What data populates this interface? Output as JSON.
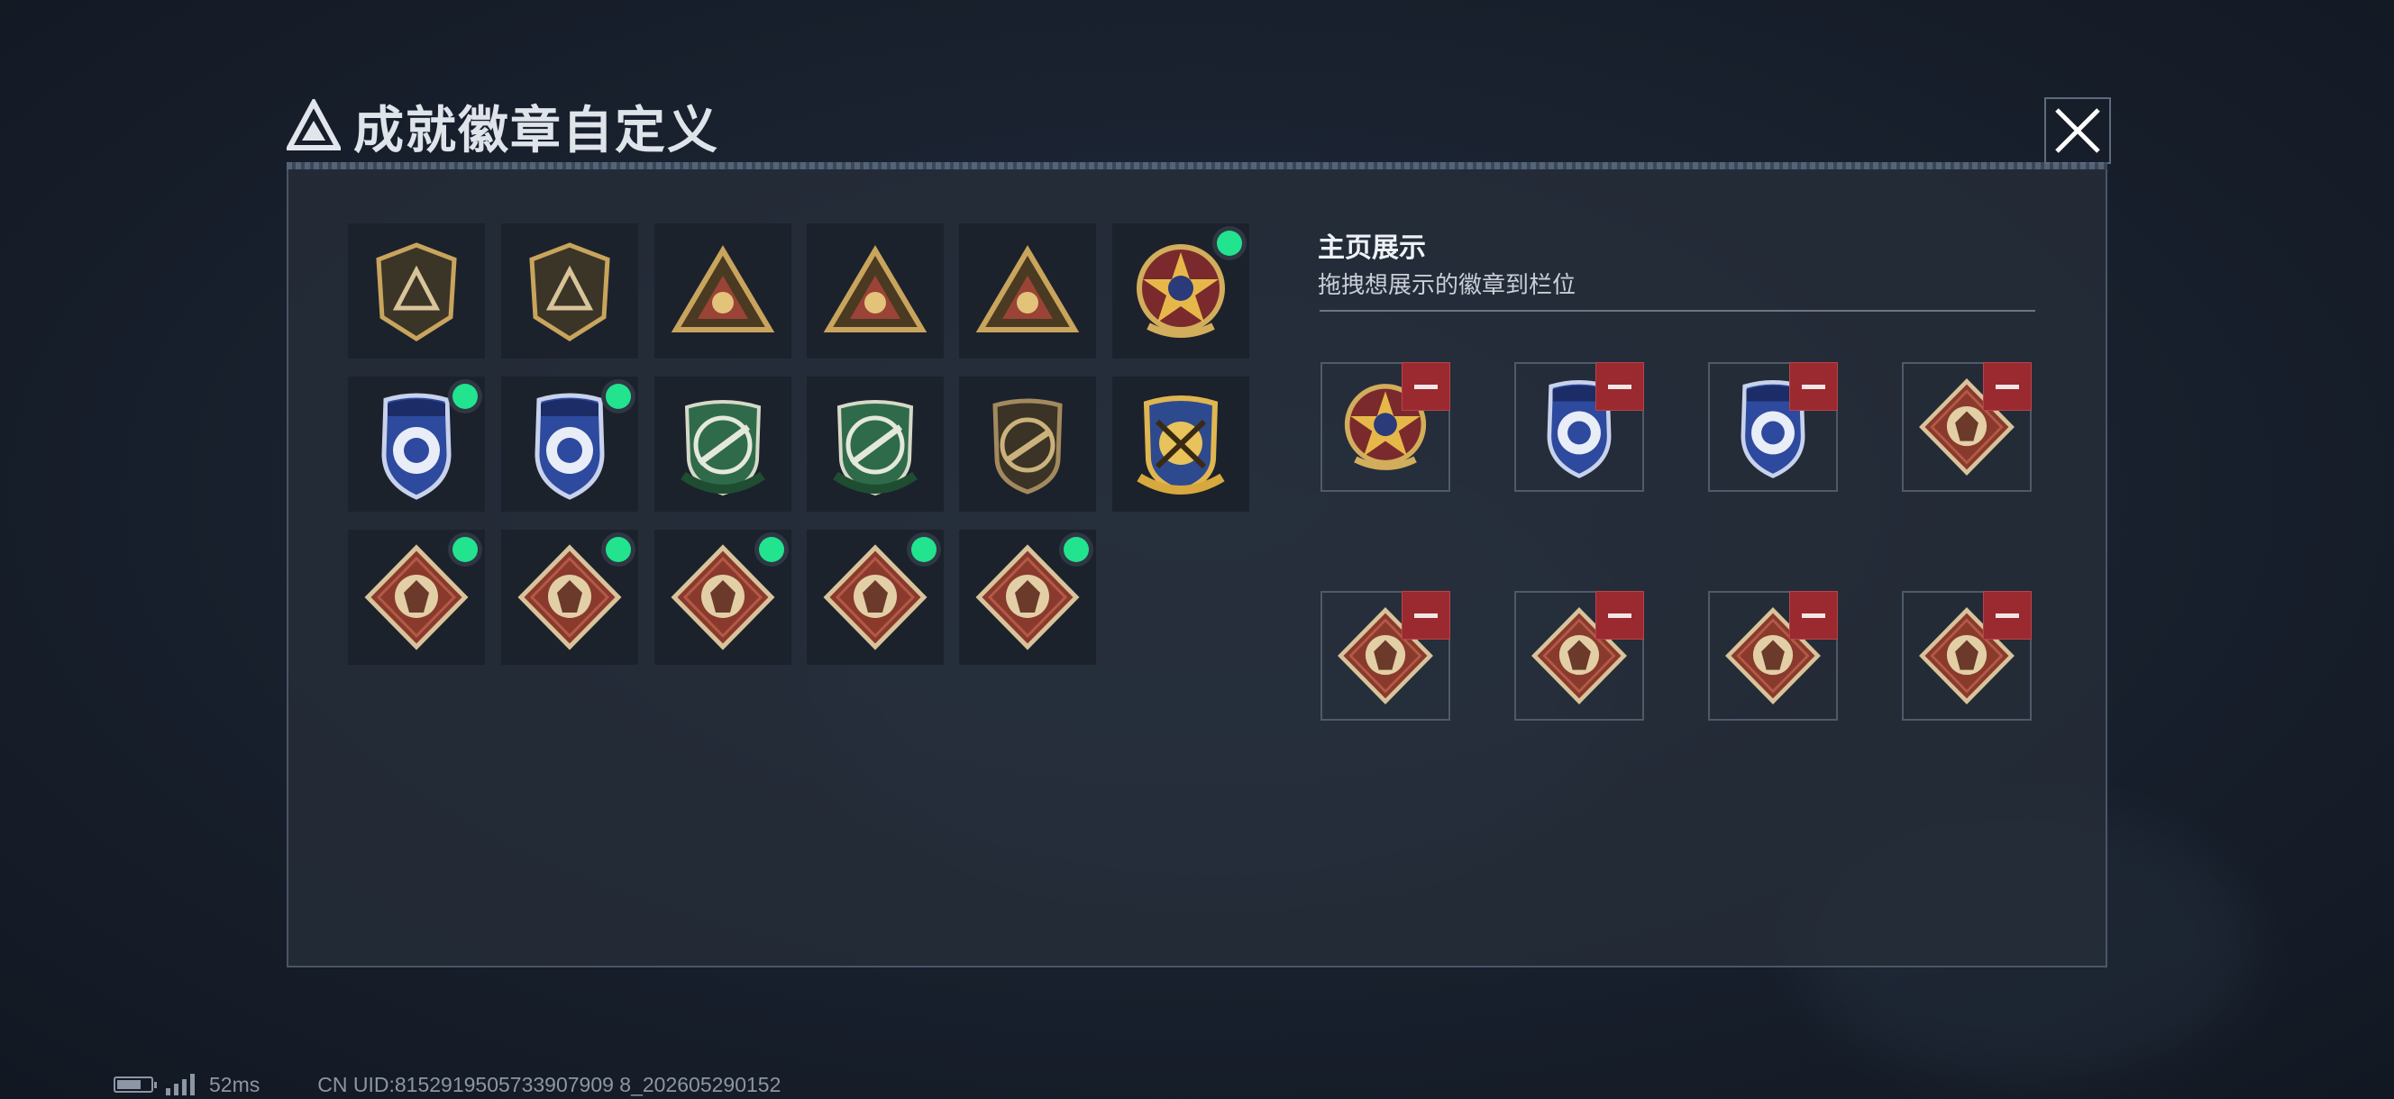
{
  "title": "成就徽章自定义",
  "showcase": {
    "heading": "主页展示",
    "subtitle": "拖拽想展示的徽章到栏位"
  },
  "badges": [
    {
      "name": "delta-triangle-badge",
      "style": "gold-shield",
      "selected": false
    },
    {
      "name": "helicopter-badge",
      "style": "gold-shield",
      "selected": false
    },
    {
      "name": "wings-badge",
      "style": "gold-triangle",
      "selected": false
    },
    {
      "name": "number-one-badge",
      "style": "gold-triangle",
      "selected": false
    },
    {
      "name": "soldiers-badge",
      "style": "gold-triangle",
      "selected": false
    },
    {
      "name": "skull-star-badge",
      "style": "star-wreath",
      "selected": true
    },
    {
      "name": "blue-shield-eye-badge",
      "style": "blue-shield",
      "selected": true
    },
    {
      "name": "blue-shield-gem-badge",
      "style": "blue-shield",
      "selected": true
    },
    {
      "name": "green-sniper-badge",
      "style": "green-crest",
      "selected": false
    },
    {
      "name": "green-rifle-badge",
      "style": "green-crest",
      "selected": false
    },
    {
      "name": "bronze-rifle-badge",
      "style": "bronze-crest",
      "selected": false
    },
    {
      "name": "gold-crossed-guns-badge",
      "style": "gold-crest",
      "selected": false
    },
    {
      "name": "wolf-badge",
      "style": "red-diamond",
      "selected": true
    },
    {
      "name": "dragon-badge",
      "style": "red-diamond",
      "selected": true
    },
    {
      "name": "runner-badge",
      "style": "red-diamond",
      "selected": true
    },
    {
      "name": "horse-badge",
      "style": "red-diamond",
      "selected": true
    },
    {
      "name": "rocket-badge",
      "style": "red-diamond",
      "selected": true
    }
  ],
  "slots": [
    {
      "name": "skull-star-badge",
      "style": "star-wreath"
    },
    {
      "name": "blue-shield-eye-badge",
      "style": "blue-shield"
    },
    {
      "name": "blue-shield-gem-badge",
      "style": "blue-shield"
    },
    {
      "name": "wolf-badge",
      "style": "red-diamond"
    },
    {
      "name": "dragon-badge",
      "style": "red-diamond"
    },
    {
      "name": "rocket-badge",
      "style": "red-diamond"
    },
    {
      "name": "horse-badge",
      "style": "red-diamond"
    },
    {
      "name": "runner-badge",
      "style": "red-diamond"
    }
  ],
  "status": {
    "ping": "52ms",
    "uid": "CN UID:8152919505733907909 8_202605290152"
  },
  "colors": {
    "selected_dot": "#22e38e",
    "remove_button": "#9a2a2f",
    "gold": "#c9a45c",
    "blue": "#2d4a9e",
    "green": "#2f6b4a",
    "red_diamond": "#8a3a2c"
  }
}
